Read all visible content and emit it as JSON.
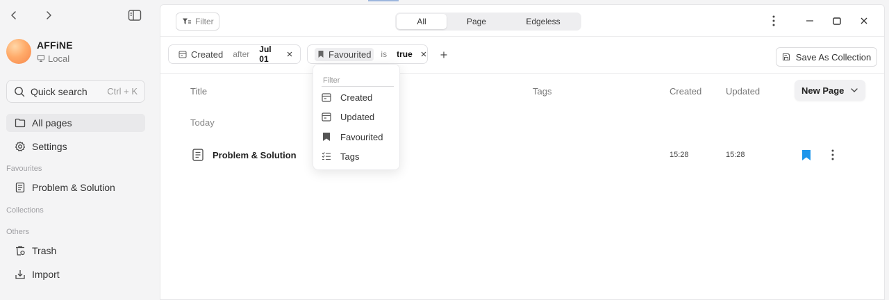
{
  "nav": {
    "back_icon": "chevron-left-icon",
    "forward_icon": "chevron-right-icon",
    "toggle_icon": "sidebar-toggle-icon"
  },
  "workspace": {
    "name": "AFFiNE",
    "type": "Local"
  },
  "search": {
    "label": "Quick search",
    "shortcut": "Ctrl + K"
  },
  "sidebar": {
    "items": [
      {
        "label": "All pages",
        "icon": "folder-icon",
        "active": true
      },
      {
        "label": "Settings",
        "icon": "gear-icon",
        "active": false
      }
    ],
    "sections": {
      "favourites": "Favourites",
      "collections": "Collections",
      "others": "Others"
    },
    "favourites": [
      {
        "label": "Problem & Solution",
        "icon": "page-icon"
      }
    ],
    "others": [
      {
        "label": "Trash",
        "icon": "trash-icon"
      },
      {
        "label": "Import",
        "icon": "import-icon"
      }
    ]
  },
  "toolbar": {
    "filter_label": "Filter",
    "tabs": [
      {
        "label": "All",
        "active": true
      },
      {
        "label": "Page",
        "active": false
      },
      {
        "label": "Edgeless",
        "active": false
      }
    ]
  },
  "filters": [
    {
      "field": "Created",
      "op": "after",
      "value": "Jul 01"
    },
    {
      "field": "Favourited",
      "op": "is",
      "value": "true"
    }
  ],
  "save_collection_label": "Save As Collection",
  "table": {
    "headers": {
      "title": "Title",
      "tags": "Tags",
      "created": "Created",
      "updated": "Updated"
    },
    "new_page_label": "New Page",
    "group_label": "Today",
    "rows": [
      {
        "title": "Problem & Solution",
        "created": "15:28",
        "updated": "15:28",
        "favourited": true
      }
    ]
  },
  "dropdown": {
    "placeholder": "Filter",
    "items": [
      {
        "label": "Created",
        "icon": "calendar-icon"
      },
      {
        "label": "Updated",
        "icon": "calendar-icon"
      },
      {
        "label": "Favourited",
        "icon": "bookmark-icon"
      },
      {
        "label": "Tags",
        "icon": "checklist-icon"
      }
    ]
  },
  "colors": {
    "accent": "#1e96eb",
    "active_bg": "#e9e9eb"
  }
}
